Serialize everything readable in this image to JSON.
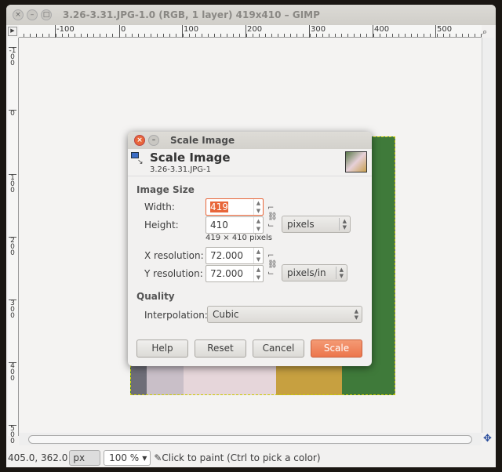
{
  "window": {
    "title": "3.26-3.31.JPG-1.0 (RGB, 1 layer) 419x410 – GIMP",
    "close": "×",
    "minimize": "–",
    "maximize": "□"
  },
  "ruler": {
    "h_labels": [
      "-100",
      "0",
      "100",
      "200",
      "300",
      "400",
      "500"
    ],
    "v_labels": [
      "-100",
      "0",
      "100",
      "200",
      "300",
      "400",
      "500"
    ]
  },
  "status": {
    "coords": "405.0, 362.0",
    "unit": "px",
    "zoom": "100 %",
    "message": "Click to paint (Ctrl to pick a color)"
  },
  "dialog": {
    "window_title": "Scale Image",
    "header_title": "Scale Image",
    "header_subtitle": "3.26-3.31.JPG-1",
    "image_size_label": "Image Size",
    "width_label": "Width:",
    "width_value": "419",
    "height_label": "Height:",
    "height_value": "410",
    "size_unit": "pixels",
    "size_info": "419 × 410 pixels",
    "xres_label": "X resolution:",
    "xres_value": "72.000",
    "yres_label": "Y resolution:",
    "yres_value": "72.000",
    "res_unit": "pixels/in",
    "quality_label": "Quality",
    "interp_label": "Interpolation:",
    "interp_value": "Cubic",
    "buttons": {
      "help": "Help",
      "reset": "Reset",
      "cancel": "Cancel",
      "scale": "Scale"
    }
  },
  "colors": {
    "accent": "#f0825a",
    "selection": "#e8663a"
  }
}
